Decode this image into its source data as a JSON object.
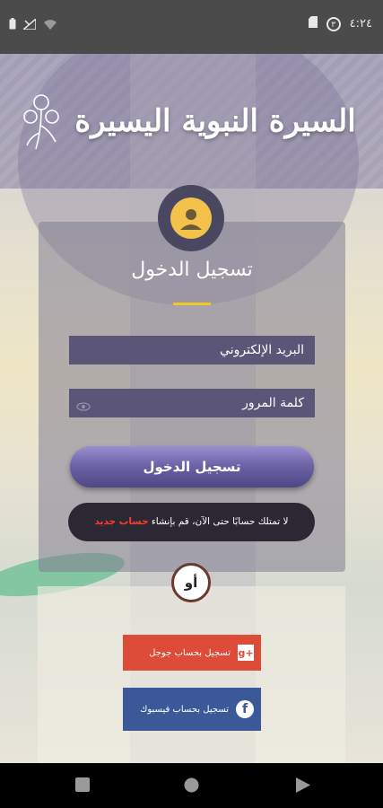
{
  "status_bar": {
    "time": "٤:٢٤",
    "notification_count": "٣"
  },
  "header": {
    "title_calligraphy": "السيرة النبوية اليسيرة"
  },
  "login": {
    "title": "تسجيل الدخول",
    "email_placeholder": "البريد الإلكتروني",
    "password_placeholder": "كلمة المرور",
    "submit_label": "تسجيل الدخول",
    "no_account_text": "لا تمتلك حسابًا حتى الآن، قم بإنشاء",
    "register_link": "حساب جديد",
    "or_label": "أو"
  },
  "social": {
    "google_label": "تسجيل بحساب جوجل",
    "facebook_label": "تسجيل بحساب فيسبوك",
    "google_color": "#dd4b39",
    "facebook_color": "#3b5998"
  },
  "colors": {
    "accent": "#6d63a8",
    "underline": "#f2c81e",
    "link": "#ff3b30"
  },
  "icons": [
    "battery-icon",
    "signal-icon",
    "wifi-icon",
    "sd-card-icon",
    "notification-icon",
    "user-avatar-icon",
    "eye-icon",
    "google-plus-icon",
    "facebook-icon",
    "back-icon",
    "home-icon",
    "recents-icon"
  ]
}
